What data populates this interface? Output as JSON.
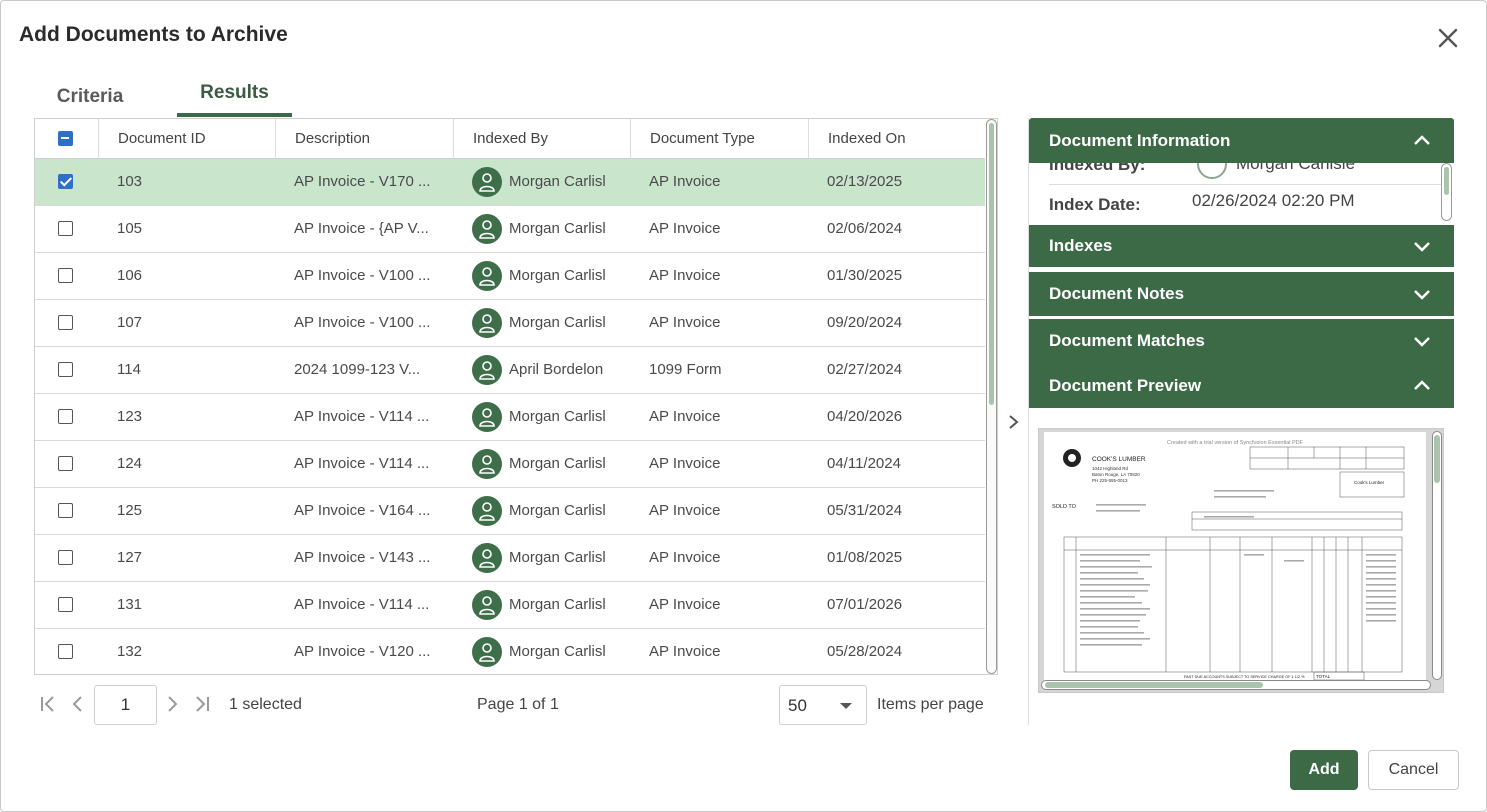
{
  "dialog": {
    "title": "Add Documents to Archive",
    "close_icon": "close-icon"
  },
  "tabs": [
    {
      "label": "Criteria",
      "active": false
    },
    {
      "label": "Results",
      "active": true
    }
  ],
  "grid": {
    "columns": [
      "Document ID",
      "Description",
      "Indexed By",
      "Document Type",
      "Indexed On"
    ],
    "header_checkbox_state": "indeterminate",
    "rows": [
      {
        "checked": true,
        "id": "103",
        "description": "AP Invoice - V170 ...",
        "indexed_by": "Morgan Carlisl",
        "type": "AP Invoice",
        "indexed_on": "02/13/2025"
      },
      {
        "checked": false,
        "id": "105",
        "description": "AP Invoice - {AP V...",
        "indexed_by": "Morgan Carlisl",
        "type": "AP Invoice",
        "indexed_on": "02/06/2024"
      },
      {
        "checked": false,
        "id": "106",
        "description": "AP Invoice - V100 ...",
        "indexed_by": "Morgan Carlisl",
        "type": "AP Invoice",
        "indexed_on": "01/30/2025"
      },
      {
        "checked": false,
        "id": "107",
        "description": "AP Invoice - V100 ...",
        "indexed_by": "Morgan Carlisl",
        "type": "AP Invoice",
        "indexed_on": "09/20/2024"
      },
      {
        "checked": false,
        "id": "114",
        "description": "2024 1099-123 V...",
        "indexed_by": "April Bordelon",
        "type": "1099 Form",
        "indexed_on": "02/27/2024"
      },
      {
        "checked": false,
        "id": "123",
        "description": "AP Invoice - V114 ...",
        "indexed_by": "Morgan Carlisl",
        "type": "AP Invoice",
        "indexed_on": "04/20/2026"
      },
      {
        "checked": false,
        "id": "124",
        "description": "AP Invoice - V114 ...",
        "indexed_by": "Morgan Carlisl",
        "type": "AP Invoice",
        "indexed_on": "04/11/2024"
      },
      {
        "checked": false,
        "id": "125",
        "description": "AP Invoice - V164 ...",
        "indexed_by": "Morgan Carlisl",
        "type": "AP Invoice",
        "indexed_on": "05/31/2024"
      },
      {
        "checked": false,
        "id": "127",
        "description": "AP Invoice - V143 ...",
        "indexed_by": "Morgan Carlisl",
        "type": "AP Invoice",
        "indexed_on": "01/08/2025"
      },
      {
        "checked": false,
        "id": "131",
        "description": "AP Invoice - V114 ...",
        "indexed_by": "Morgan Carlisl",
        "type": "AP Invoice",
        "indexed_on": "07/01/2026"
      },
      {
        "checked": false,
        "id": "132",
        "description": "AP Invoice - V120 ...",
        "indexed_by": "Morgan Carlisl",
        "type": "AP Invoice",
        "indexed_on": "05/28/2024"
      }
    ]
  },
  "pager": {
    "page_input": "1",
    "selected_text": "1 selected",
    "page_info": "Page 1 of 1",
    "page_size": "50",
    "items_per_page_label": "Items per page"
  },
  "panel": {
    "document_information": {
      "title": "Document Information",
      "expanded": true,
      "indexed_by_label": "Indexed By:",
      "indexed_by_value": "Morgan Carlisle",
      "index_date_label": "Index Date:",
      "index_date_value": "02/26/2024 02:20 PM"
    },
    "indexes_title": "Indexes",
    "notes_title": "Document Notes",
    "matches_title": "Document Matches",
    "preview_title": "Document Preview",
    "preview": {
      "watermark": "Created with a trial version of Syncfusion Essential PDF",
      "company": "COOK'S LUMBER",
      "company_address": "1042 Highland Rd",
      "company_city": "Baton Rouge, LA 70820",
      "company_phone": "PH 225-555-0013",
      "sold_to_label": "SOLD TO",
      "ship_to_name": "Cook's Lumber",
      "total_label": "TOTAL",
      "past_due_text": "PAST DUE ACCOUNTS SUBJECT TO SERVICE CHARGE OF 1 1/2 %"
    }
  },
  "buttons": {
    "add": "Add",
    "cancel": "Cancel"
  },
  "colors": {
    "primary_green": "#3c6a47",
    "selected_row": "#c9e6cd",
    "checkbox_blue": "#2f6fc7"
  }
}
